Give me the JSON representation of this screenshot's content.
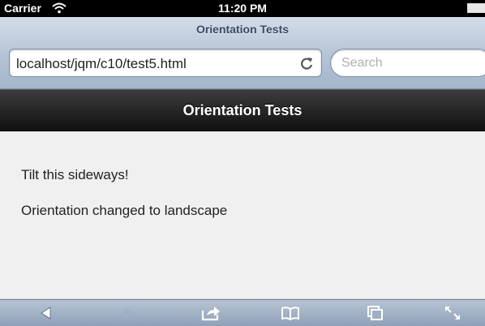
{
  "status_bar": {
    "carrier": "Carrier",
    "time": "11:20 PM",
    "icons": [
      "wifi-icon",
      "battery-icon"
    ]
  },
  "browser": {
    "page_title": "Orientation Tests",
    "url": "localhost/jqm/c10/test5.html",
    "search_placeholder": "Search",
    "toolbar_icons": [
      "back-icon",
      "forward-icon",
      "share-icon",
      "bookmarks-icon",
      "tabs-icon",
      "fullscreen-icon"
    ]
  },
  "header": {
    "title": "Orientation Tests"
  },
  "content": {
    "lines": [
      "Tilt this sideways!",
      "Orientation changed to landscape"
    ]
  },
  "colors": {
    "header_bg": "#1e1e1e",
    "chrome_bg": "#b4c3d5",
    "content_bg": "#f0f0f0"
  }
}
